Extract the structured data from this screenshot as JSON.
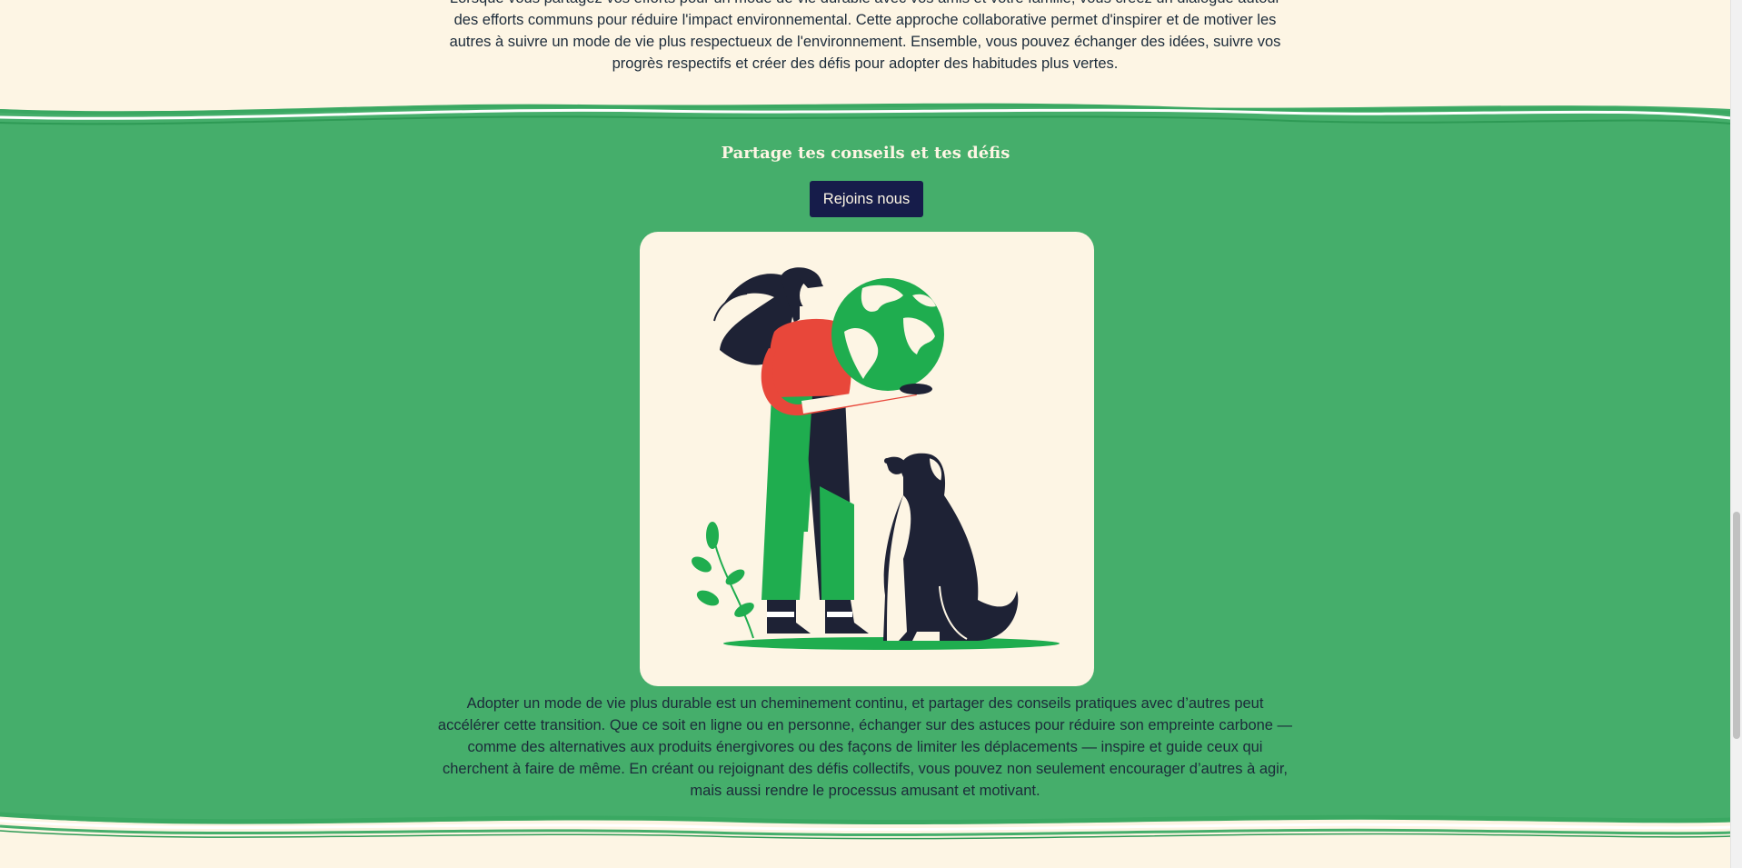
{
  "intro": {
    "text": "Lorsque vous partagez vos efforts pour un mode de vie durable avec vos amis et votre famille, vous créez un dialogue autour des efforts communs pour réduire l'impact environnemental. Cette approche collaborative permet d'inspirer et de motiver les autres à suivre un mode de vie plus respectueux de l'environnement. Ensemble, vous pouvez échanger des idées, suivre vos progrès respectifs et créer des défis pour adopter des habitudes plus vertes."
  },
  "share": {
    "title": "Partage tes conseils et tes défis",
    "button_label": "Rejoins nous",
    "paragraph": "Adopter un mode de vie plus durable est un cheminement continu, et partager des conseils pratiques avec d’autres peut accélérer cette transition. Que ce soit en ligne ou en personne, échanger sur des astuces pour réduire son empreinte carbone — comme des alternatives aux produits énergivores ou des façons de limiter les déplacements — inspire et guide ceux qui cherchent à faire de même. En créant ou rejoignant des défis collectifs, vous pouvez non seulement encourager d’autres à agir, mais aussi rendre le processus amusant et motivant."
  },
  "illustration": {
    "icon": "woman-holding-globe-with-dog-illustration"
  },
  "colors": {
    "background": "#fdf5e4",
    "band": "#45ae6b",
    "button": "#161c4a",
    "text": "#1c2b3a",
    "illustration_green": "#1fad4f",
    "illustration_red": "#e8473a",
    "illustration_navy": "#1e2235"
  }
}
